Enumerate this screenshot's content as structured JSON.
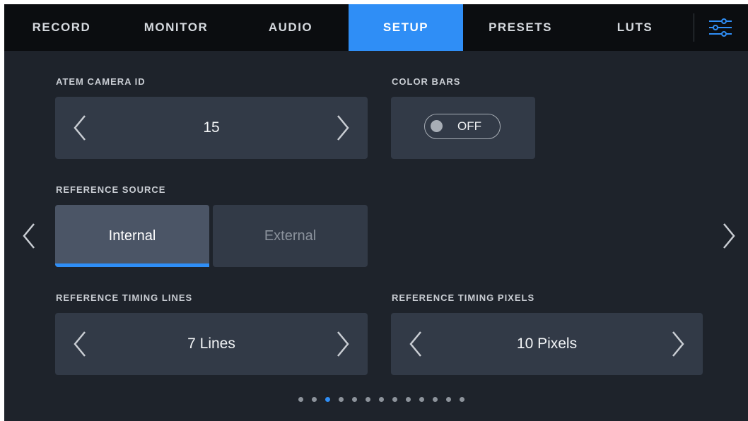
{
  "tabs": [
    {
      "label": "RECORD",
      "active": false
    },
    {
      "label": "MONITOR",
      "active": false
    },
    {
      "label": "AUDIO",
      "active": false
    },
    {
      "label": "SETUP",
      "active": true
    },
    {
      "label": "PRESETS",
      "active": false
    },
    {
      "label": "LUTS",
      "active": false
    }
  ],
  "menu_icon": "sliders-icon",
  "atem_camera_id": {
    "label": "ATEM CAMERA ID",
    "value": "15"
  },
  "color_bars": {
    "label": "COLOR BARS",
    "state": "OFF"
  },
  "reference_source": {
    "label": "REFERENCE SOURCE",
    "options": [
      "Internal",
      "External"
    ],
    "selected": "Internal"
  },
  "reference_timing_lines": {
    "label": "REFERENCE TIMING LINES",
    "value": "7 Lines"
  },
  "reference_timing_pixels": {
    "label": "REFERENCE TIMING PIXELS",
    "value": "10 Pixels"
  },
  "pagination": {
    "total": 13,
    "current": 3
  },
  "colors": {
    "accent": "#2f8ef6",
    "background": "#1e232b",
    "panel": "#323a47",
    "tabbar": "#0b0d10"
  }
}
